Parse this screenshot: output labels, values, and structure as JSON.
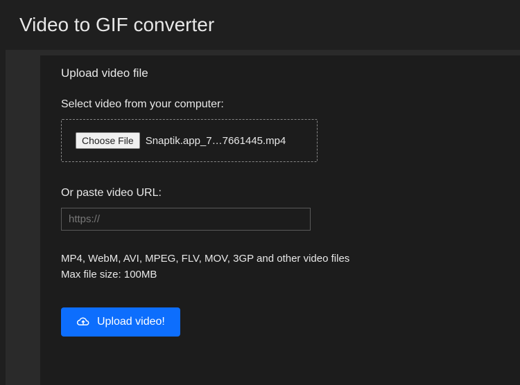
{
  "header": {
    "title": "Video to GIF converter"
  },
  "upload_panel": {
    "title": "Upload video file",
    "file_section": {
      "label": "Select video from your computer:",
      "button_label": "Choose File",
      "selected_filename": "Snaptik.app_7…7661445.mp4"
    },
    "url_section": {
      "label": "Or paste video URL:",
      "placeholder": "https://",
      "value": ""
    },
    "info": {
      "formats_line": "MP4, WebM, AVI, MPEG, FLV, MOV, 3GP and other video files",
      "max_size_line": "Max file size: 100MB"
    },
    "submit_button_label": "Upload video!"
  }
}
